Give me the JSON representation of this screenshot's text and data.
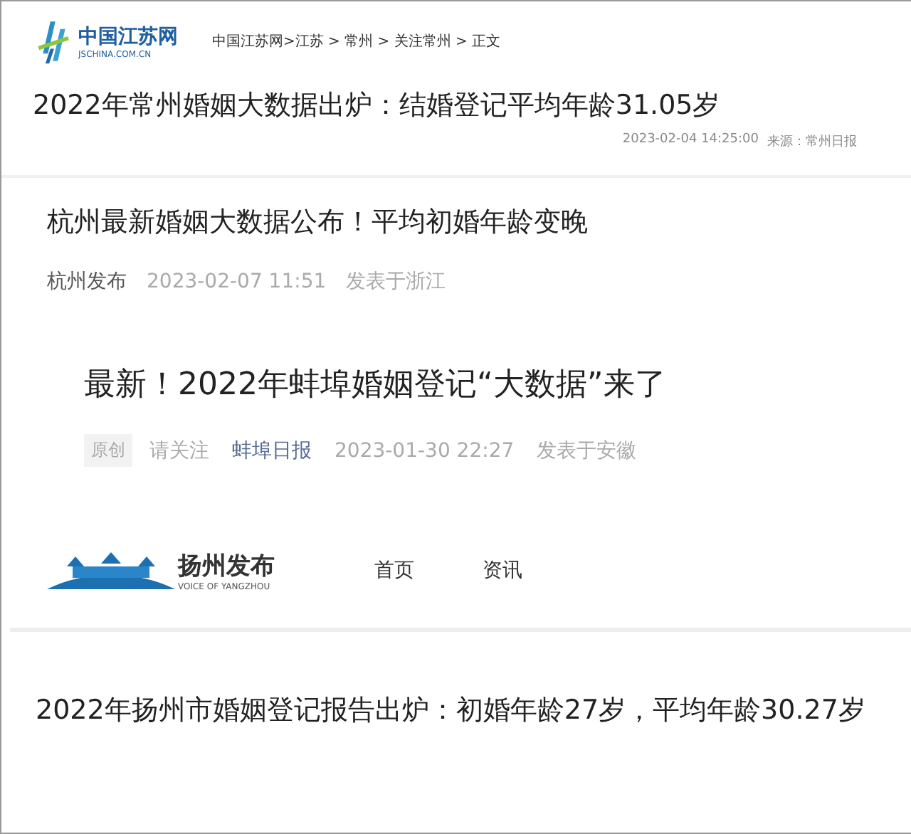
{
  "jschina": {
    "logo_name": "中国江苏网",
    "logo_domain": "JSCHINA.COM.CN",
    "breadcrumb": "中国江苏网>江苏 > 常州 > 关注常州 > 正文",
    "title": "2022年常州婚姻大数据出炉：结婚登记平均年龄31.05岁",
    "datetime": "2023-02-04 14:25:00",
    "source": "来源：常州日报"
  },
  "hangzhou": {
    "title": "杭州最新婚姻大数据公布！平均初婚年龄变晚",
    "author": "杭州发布",
    "datetime": "2023-02-07 11:51",
    "location": "发表于浙江"
  },
  "bengbu": {
    "title": "最新！2022年蚌埠婚姻登记“大数据”来了",
    "badge": "原创",
    "follow": "请关注",
    "author": "蚌埠日报",
    "datetime": "2023-01-30 22:27",
    "location": "发表于安徽"
  },
  "yangzhou": {
    "logo_name": "扬州发布",
    "logo_tagline": "VOICE OF YANGZHOU",
    "nav": [
      {
        "label": "首页"
      },
      {
        "label": "资讯"
      }
    ],
    "title": "2022年扬州市婚姻登记报告出炉：初婚年龄27岁，平均年龄30.27岁"
  }
}
